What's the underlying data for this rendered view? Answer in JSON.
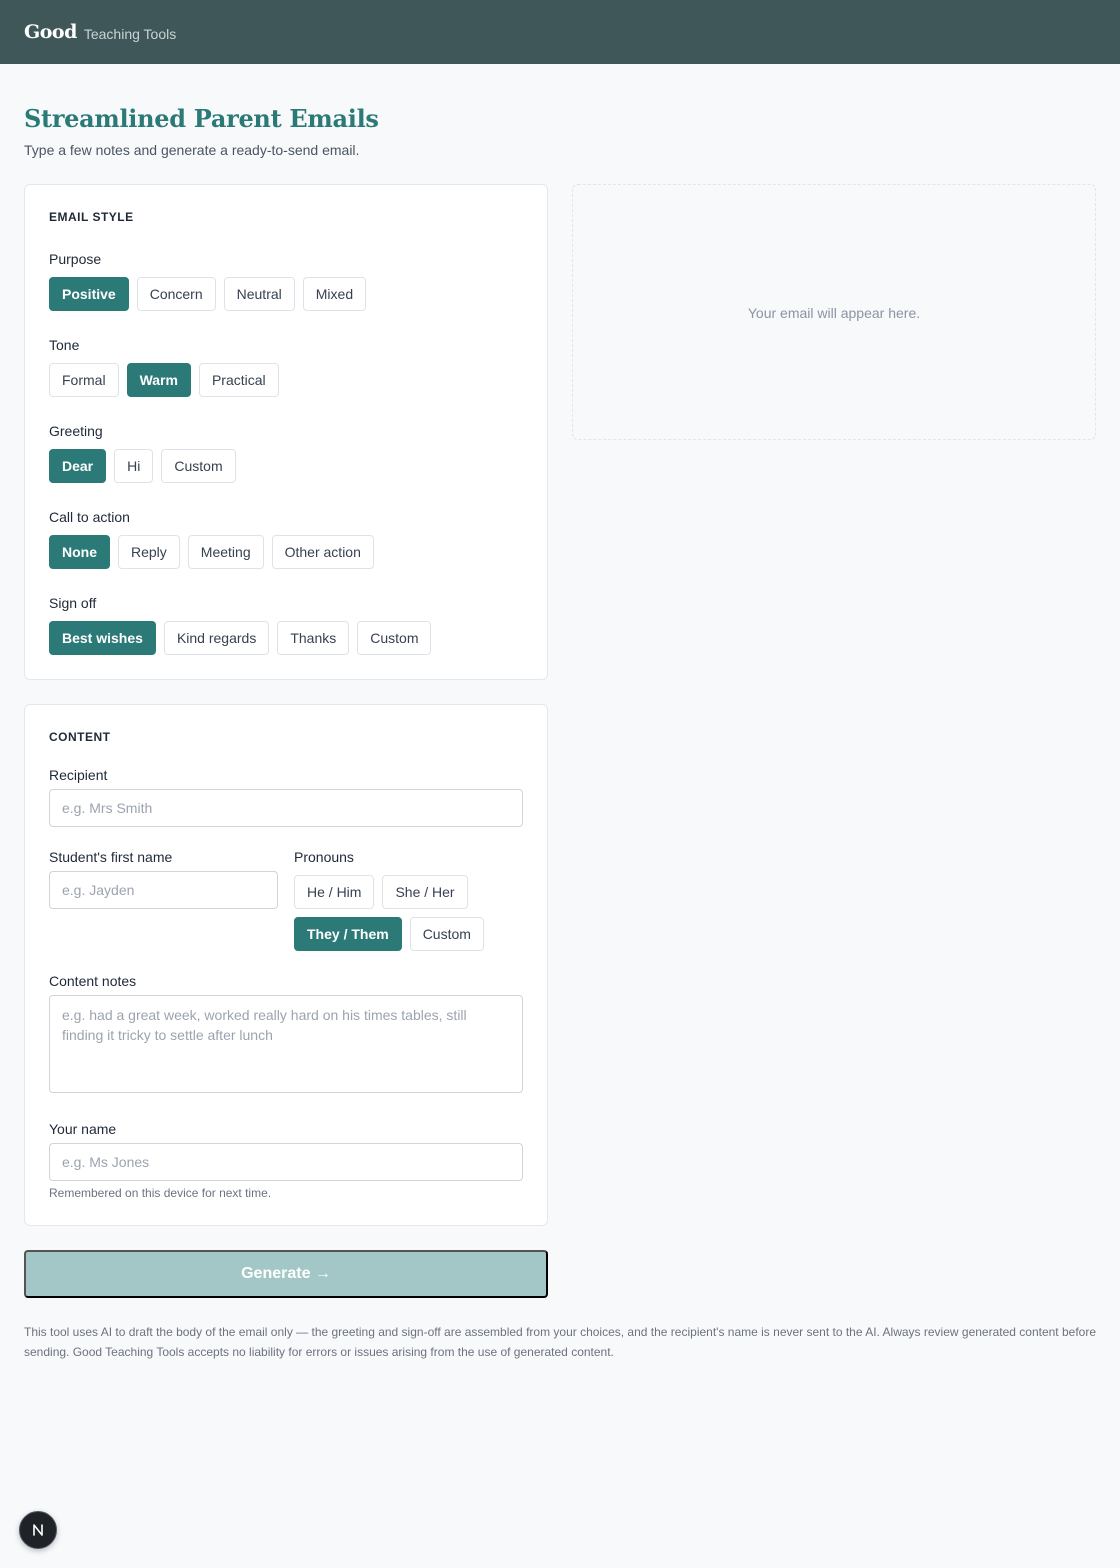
{
  "header": {
    "logo": "Good",
    "app_name": "Teaching Tools"
  },
  "page": {
    "title": "Streamlined Parent Emails",
    "subtitle": "Type a few notes and generate a ready-to-send email."
  },
  "email_style": {
    "heading": "EMAIL STYLE",
    "purpose": {
      "label": "Purpose",
      "options": [
        "Positive",
        "Concern",
        "Neutral",
        "Mixed"
      ],
      "selected": "Positive"
    },
    "tone": {
      "label": "Tone",
      "options": [
        "Formal",
        "Warm",
        "Practical"
      ],
      "selected": "Warm"
    },
    "greeting": {
      "label": "Greeting",
      "options": [
        "Dear",
        "Hi",
        "Custom"
      ],
      "selected": "Dear"
    },
    "call_to_action": {
      "label": "Call to action",
      "options": [
        "None",
        "Reply",
        "Meeting",
        "Other action"
      ],
      "selected": "None"
    },
    "sign_off": {
      "label": "Sign off",
      "options": [
        "Best wishes",
        "Kind regards",
        "Thanks",
        "Custom"
      ],
      "selected": "Best wishes"
    }
  },
  "content": {
    "heading": "CONTENT",
    "recipient": {
      "label": "Recipient",
      "placeholder": "e.g. Mrs Smith",
      "value": ""
    },
    "student_name": {
      "label": "Student's first name",
      "placeholder": "e.g. Jayden",
      "value": ""
    },
    "pronouns": {
      "label": "Pronouns",
      "options": [
        "He / Him",
        "She / Her",
        "They / Them",
        "Custom"
      ],
      "selected": "They / Them"
    },
    "notes": {
      "label": "Content notes",
      "placeholder": "e.g. had a great week, worked really hard on his times tables, still finding it tricky to settle after lunch",
      "value": ""
    },
    "your_name": {
      "label": "Your name",
      "placeholder": "e.g. Ms Jones",
      "value": "",
      "hint": "Remembered on this device for next time."
    }
  },
  "actions": {
    "generate_label": "Generate →",
    "generate_enabled": false
  },
  "preview": {
    "empty_text": "Your email will appear here."
  },
  "footer": {
    "disclaimer": "This tool uses AI to draft the body of the email only — the greeting and sign-off are assembled from your choices, and the recipient's name is never sent to the AI. Always review generated content before sending. Good Teaching Tools accepts no liability for errors or issues arising from the use of generated content."
  },
  "dev_badge": {
    "icon": "next-logo-icon"
  },
  "colors": {
    "header_bg": "#3f5759",
    "accent": "#2c7a78",
    "button_disabled": "#a3c7c6",
    "page_bg": "#f8f9fa"
  }
}
